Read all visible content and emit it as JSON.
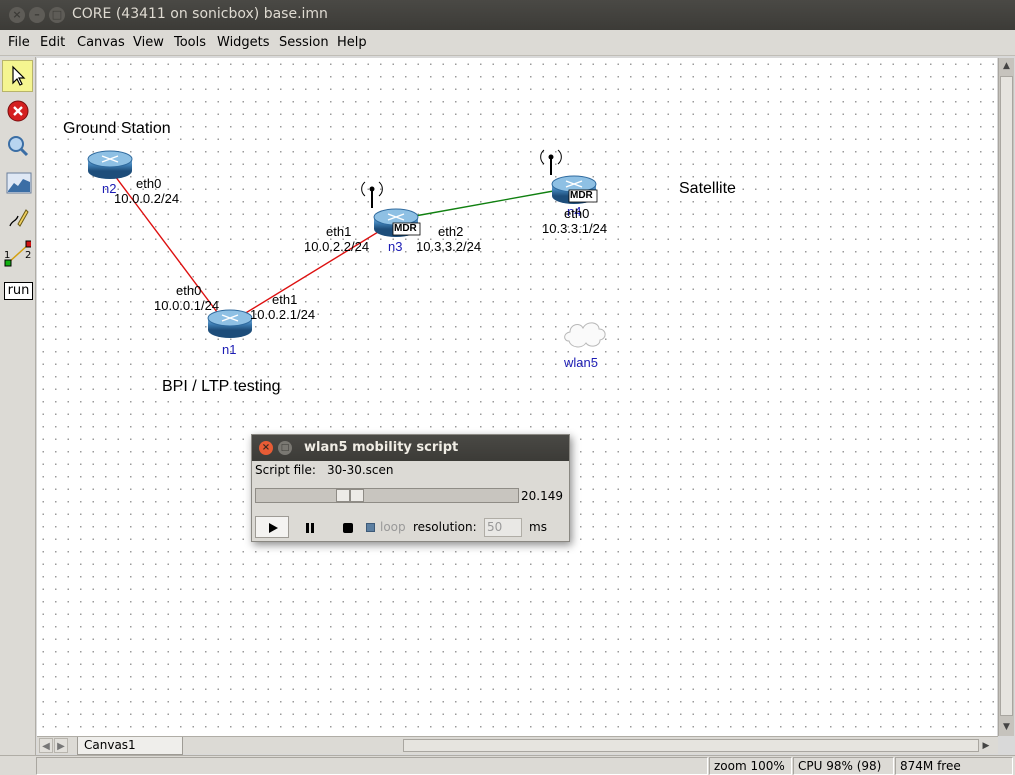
{
  "window": {
    "title": "CORE (43411 on sonicbox) base.imn"
  },
  "menu": [
    "File",
    "Edit",
    "Canvas",
    "View",
    "Tools",
    "Widgets",
    "Session",
    "Help"
  ],
  "toolbar": {
    "tools": [
      "select-tool",
      "stop-tool",
      "observer-tool",
      "plot-tool",
      "marker-tool",
      "two-node-tool",
      "run-tool"
    ],
    "run_label": "run"
  },
  "canvas": {
    "annotations": {
      "ground_station": "Ground Station",
      "satellite": "Satellite",
      "bpi": "BPI / LTP testing"
    },
    "nodes": {
      "n2": {
        "name": "n2",
        "iface": "eth0",
        "ip": "10.0.0.2/24"
      },
      "n1": {
        "name": "n1",
        "iface0": "eth0",
        "ip0": "10.0.0.1/24",
        "iface1": "eth1",
        "ip1": "10.0.2.1/24"
      },
      "n3": {
        "name": "n3",
        "badge": "MDR",
        "iface1": "eth1",
        "ip1": "10.0.2.2/24",
        "iface2": "eth2",
        "ip2": "10.3.3.2/24"
      },
      "n4": {
        "name": "n4",
        "badge": "MDR",
        "iface": "eth0",
        "ip": "10.3.3.1/24"
      },
      "wlan5": {
        "name": "wlan5"
      }
    },
    "link_colors": {
      "red": "#dd1010",
      "green": "#108010"
    }
  },
  "tabs": {
    "active": "Canvas1"
  },
  "status": {
    "zoom": "zoom 100%",
    "cpu": "CPU 98% (98)",
    "mem": "874M free"
  },
  "mobility": {
    "title": "wlan5 mobility script",
    "script_label": "Script file:",
    "script_file": "30-30.scen",
    "time": "20.149",
    "loop_label": "loop",
    "resolution_label": "resolution:",
    "resolution": "50",
    "unit": "ms",
    "progress_fraction": 0.34
  }
}
